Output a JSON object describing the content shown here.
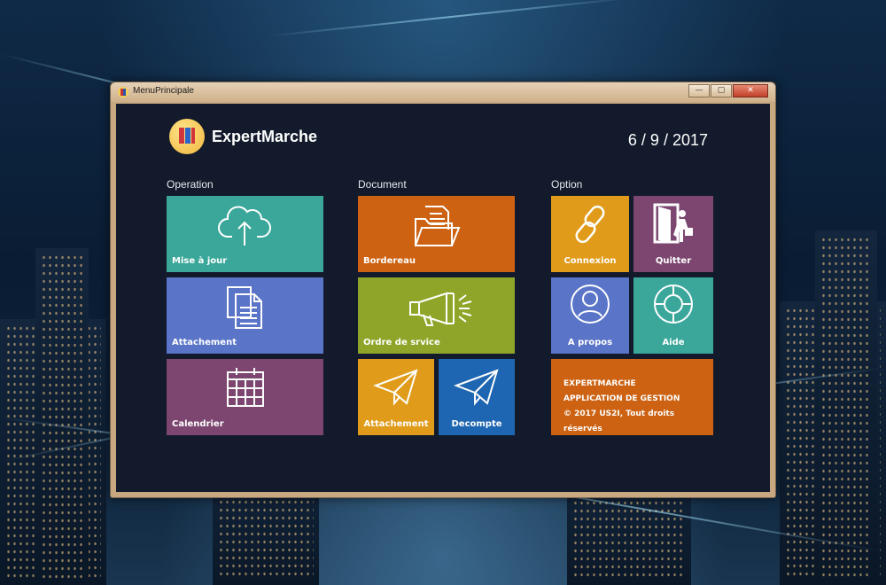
{
  "window": {
    "title": "MenuPrincipale",
    "controls": {
      "minimize": "—",
      "maximize": "▢",
      "close": "✕"
    }
  },
  "header": {
    "app_name": "ExpertMarche",
    "date": "6 / 9 / 2017"
  },
  "sections": {
    "operation": {
      "title": "Operation",
      "tiles": [
        {
          "label": "Mise à jour",
          "icon": "cloud-upload-icon",
          "color": "#3aa79a"
        },
        {
          "label": "Attachement",
          "icon": "documents-icon",
          "color": "#5a74c8"
        },
        {
          "label": "Calendrier",
          "icon": "calendar-icon",
          "color": "#7c4670"
        }
      ]
    },
    "document": {
      "title": "Document",
      "tiles": [
        {
          "label": "Bordereau",
          "icon": "folder-icon",
          "color": "#cc6212"
        },
        {
          "label": "Ordre de srvice",
          "icon": "megaphone-icon",
          "color": "#8fa52a"
        },
        {
          "label": "Attachement",
          "icon": "paper-plane-icon",
          "color": "#e19b1b"
        },
        {
          "label": "Decompte",
          "icon": "paper-plane-icon",
          "color": "#1e66b1"
        }
      ]
    },
    "option": {
      "title": "Option",
      "tiles": [
        {
          "label": "Connexion",
          "icon": "link-icon",
          "color": "#e19b1b"
        },
        {
          "label": "Quitter",
          "icon": "exit-icon",
          "color": "#7c4670"
        },
        {
          "label": "A propos",
          "icon": "user-icon",
          "color": "#5a74c8"
        },
        {
          "label": "Aide",
          "icon": "lifebuoy-icon",
          "color": "#3aa79a"
        }
      ],
      "info": {
        "line1": "EXPERTMARCHE",
        "line2": "APPLICATION DE GESTION",
        "line3": "© 2017 US2I, Tout droits réservés",
        "color": "#cc6212"
      }
    }
  }
}
